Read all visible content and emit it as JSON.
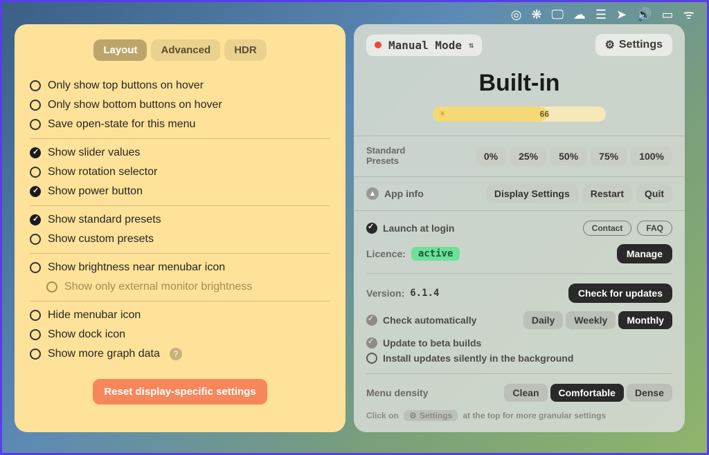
{
  "menubar_icons": [
    "record-icon",
    "pizza-icon",
    "display-icon",
    "cloud-icon",
    "drives-icon",
    "location-icon",
    "volume-icon",
    "battery-icon",
    "wifi-icon"
  ],
  "left": {
    "tabs": {
      "layout": "Layout",
      "advanced": "Advanced",
      "hdr": "HDR",
      "active": "layout"
    },
    "groups": [
      [
        {
          "key": "only_top_hover",
          "label": "Only show top buttons on hover",
          "checked": false
        },
        {
          "key": "only_bottom_hover",
          "label": "Only show bottom buttons on hover",
          "checked": false
        },
        {
          "key": "save_open_state",
          "label": "Save open-state for this menu",
          "checked": false
        }
      ],
      [
        {
          "key": "show_slider_values",
          "label": "Show slider values",
          "checked": true
        },
        {
          "key": "show_rotation",
          "label": "Show rotation selector",
          "checked": false
        },
        {
          "key": "show_power",
          "label": "Show power button",
          "checked": true
        }
      ],
      [
        {
          "key": "show_std_presets",
          "label": "Show standard presets",
          "checked": true
        },
        {
          "key": "show_custom_presets",
          "label": "Show custom presets",
          "checked": false
        }
      ],
      [
        {
          "key": "show_brightness_menubar",
          "label": "Show brightness near menubar icon",
          "checked": false
        },
        {
          "key": "only_external",
          "label": "Show only external monitor brightness",
          "checked": false,
          "sub": true
        }
      ],
      [
        {
          "key": "hide_menubar_icon",
          "label": "Hide menubar icon",
          "checked": false
        },
        {
          "key": "show_dock_icon",
          "label": "Show dock icon",
          "checked": false
        },
        {
          "key": "show_more_graph",
          "label": "Show more graph data",
          "checked": false,
          "help": true
        }
      ]
    ],
    "reset": "Reset display-specific settings"
  },
  "right": {
    "mode": "Manual Mode",
    "settings": "Settings",
    "display_name": "Built-in",
    "brightness": 66,
    "presets_label_a": "Standard",
    "presets_label_b": "Presets",
    "presets": [
      "0%",
      "25%",
      "50%",
      "75%",
      "100%"
    ],
    "appinfo": "App info",
    "display_settings": "Display Settings",
    "restart": "Restart",
    "quit": "Quit",
    "launch_login": "Launch at login",
    "contact": "Contact",
    "faq": "FAQ",
    "licence_label": "Licence:",
    "licence_value": "active",
    "manage": "Manage",
    "version_label": "Version:",
    "version_value": "6.1.4",
    "check_updates": "Check for updates",
    "check_auto": "Check automatically",
    "update_freq": {
      "daily": "Daily",
      "weekly": "Weekly",
      "monthly": "Monthly",
      "active": "monthly"
    },
    "update_beta": "Update to beta builds",
    "install_silent": "Install updates silently in the background",
    "menu_density": "Menu density",
    "density": {
      "clean": "Clean",
      "comfortable": "Comfortable",
      "dense": "Dense",
      "active": "comfortable"
    },
    "hint_a": "Click on",
    "hint_chip": "Settings",
    "hint_b": "at the top for more granular settings"
  }
}
